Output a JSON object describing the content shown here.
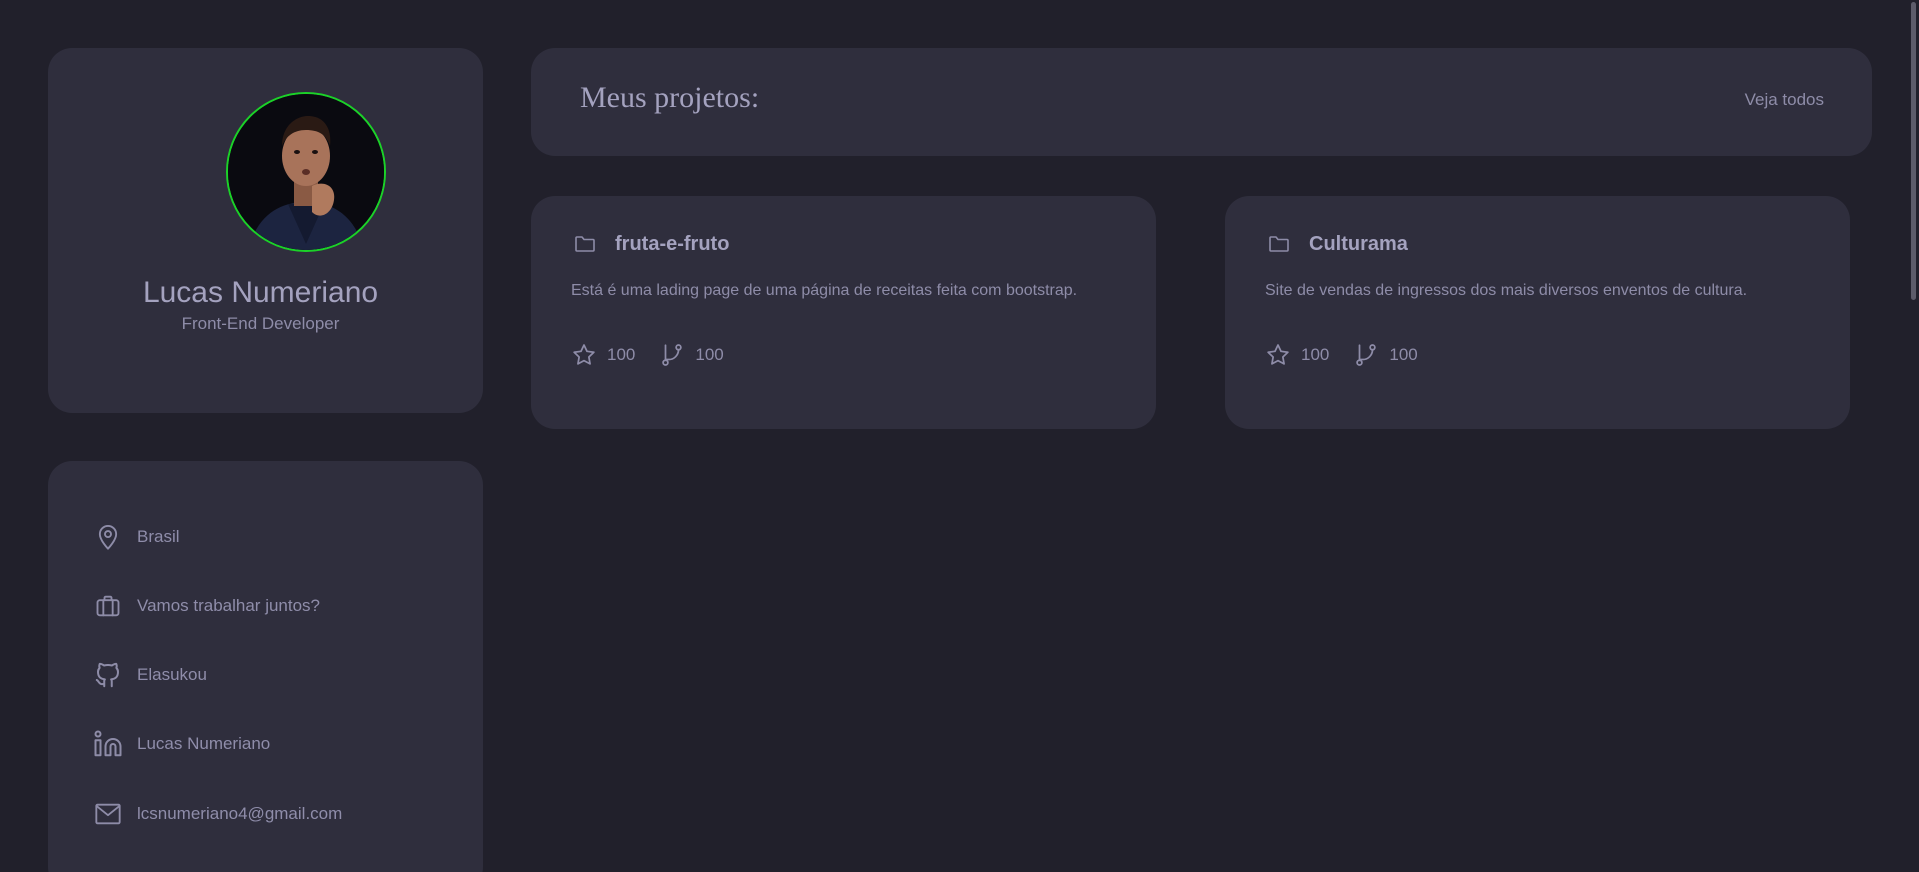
{
  "profile": {
    "name": "Lucas Numeriano",
    "role": "Front-End Developer",
    "avatar_border_color": "#1bd228"
  },
  "info": {
    "items": [
      {
        "icon": "location-pin-icon",
        "label": "Brasil"
      },
      {
        "icon": "briefcase-icon",
        "label": "Vamos trabalhar juntos?"
      },
      {
        "icon": "github-icon",
        "label": "Elasukou"
      },
      {
        "icon": "linkedin-icon",
        "label": "Lucas Numeriano"
      },
      {
        "icon": "mail-icon",
        "label": "lcsnumeriano4@gmail.com"
      }
    ]
  },
  "projects_header": {
    "title": "Meus projetos:",
    "see_all_label": "Veja todos"
  },
  "projects": [
    {
      "title": "fruta-e-fruto",
      "description": "Está é uma lading page de uma página de receitas feita com bootstrap.",
      "stars": "100",
      "forks": "100"
    },
    {
      "title": "Culturama",
      "description": "Site de vendas de ingressos dos mais diversos enventos de cultura.",
      "stars": "100",
      "forks": "100"
    }
  ],
  "colors": {
    "background": "#21202b",
    "card": "#2f2e3d",
    "text": "#8e8ca8",
    "accent": "#1bd228"
  }
}
